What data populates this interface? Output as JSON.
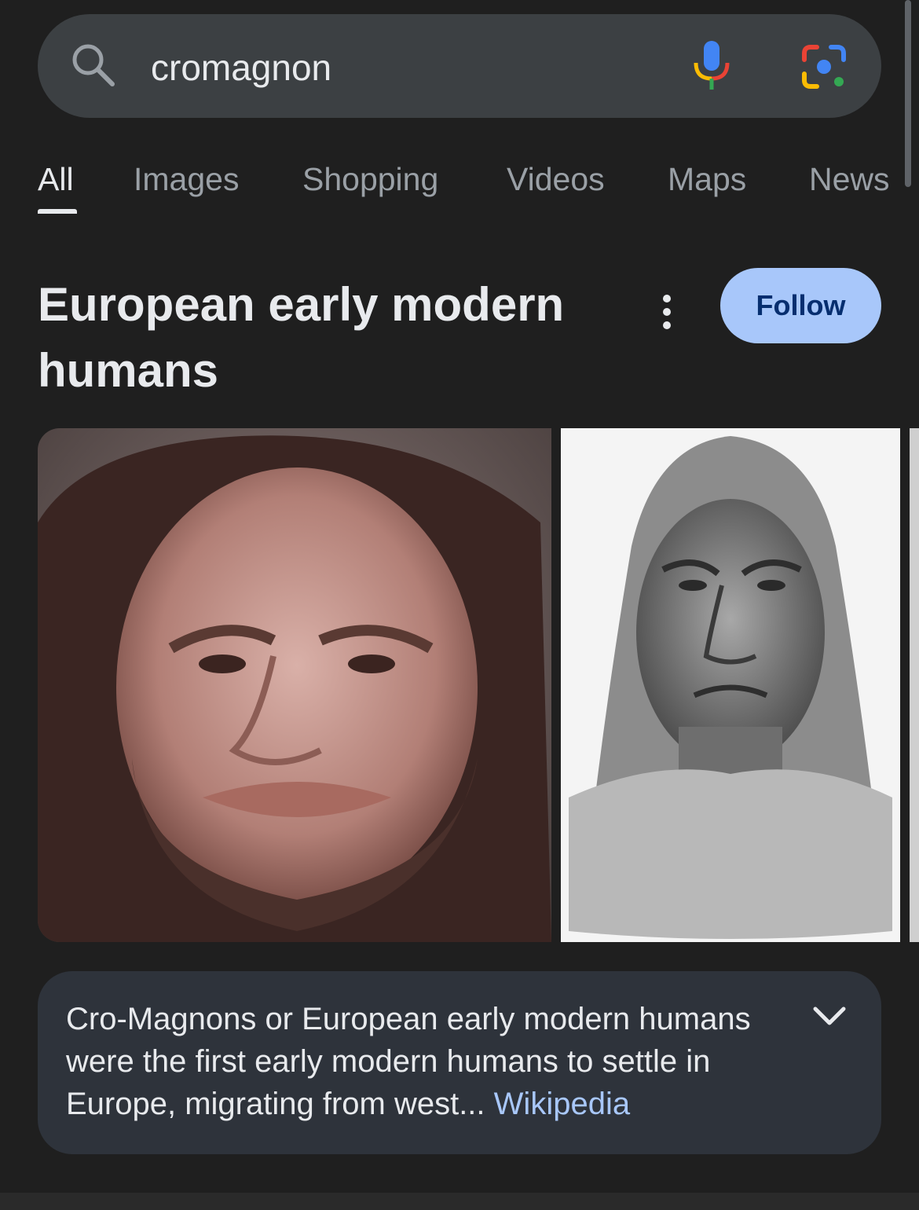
{
  "search": {
    "query": "cromagnon",
    "icons": {
      "search": "search-icon",
      "mic": "mic-icon",
      "lens": "google-lens-icon"
    }
  },
  "tabs": [
    {
      "label": "All",
      "active": true
    },
    {
      "label": "Images"
    },
    {
      "label": "Shopping"
    },
    {
      "label": "Videos"
    },
    {
      "label": "Maps"
    },
    {
      "label": "News"
    }
  ],
  "knowledge_panel": {
    "title": "European early modern humans",
    "follow_label": "Follow",
    "summary": "Cro-Magnons or European early modern humans were the first early modern humans to settle in Europe, migrating from west...",
    "source_label": "Wikipedia"
  },
  "colors": {
    "background": "#1f1f1f",
    "follow_button": "#a8c7fa",
    "link": "#a8c7fa",
    "summary_card": "#2e333b"
  }
}
